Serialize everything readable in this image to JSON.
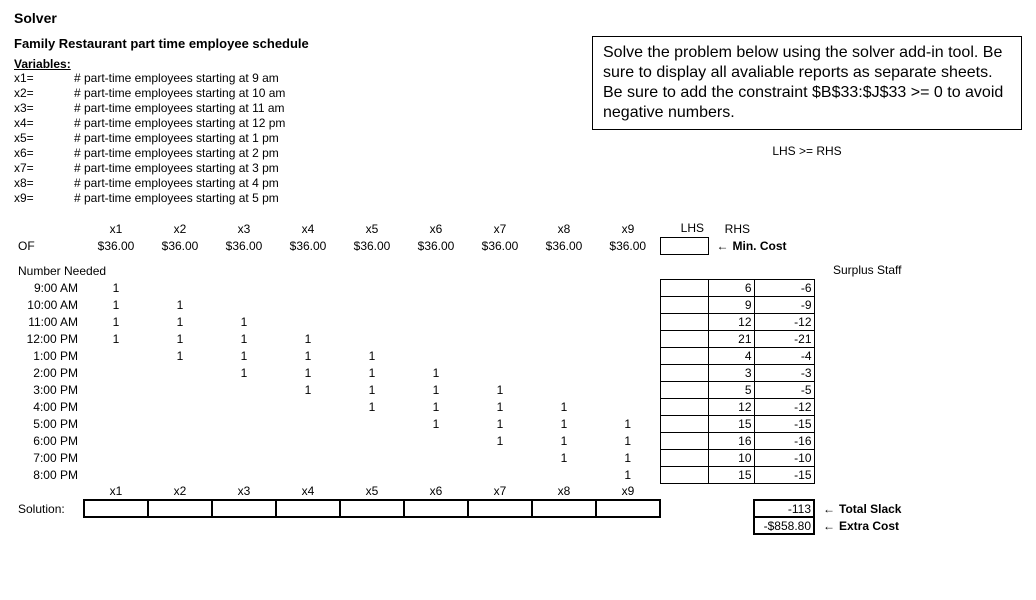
{
  "title": "Solver",
  "subtitle": "Family Restaurant part time employee schedule",
  "callout": "Solve the problem below using the solver add-in tool.  Be sure to display all avaliable reports as separate sheets.  Be sure to add the constraint $B$33:$J$33 >= 0 to avoid negative numbers.",
  "lhs_rhs_note": "LHS >= RHS",
  "variables_header": "Variables:",
  "variables": [
    {
      "name": "x1=",
      "desc": "# part-time employees starting at 9 am"
    },
    {
      "name": "x2=",
      "desc": "# part-time employees starting at 10 am"
    },
    {
      "name": "x3=",
      "desc": "# part-time employees starting at 11 am"
    },
    {
      "name": "x4=",
      "desc": "# part-time employees starting at 12 pm"
    },
    {
      "name": "x5=",
      "desc": "# part-time employees starting at 1 pm"
    },
    {
      "name": "x6=",
      "desc": "# part-time employees starting at 2 pm"
    },
    {
      "name": "x7=",
      "desc": "# part-time employees starting at 3 pm"
    },
    {
      "name": "x8=",
      "desc": "# part-time employees starting at 4 pm"
    },
    {
      "name": "x9=",
      "desc": "# part-time employees starting at 5 pm"
    }
  ],
  "x_headers": [
    "x1",
    "x2",
    "x3",
    "x4",
    "x5",
    "x6",
    "x7",
    "x8",
    "x9"
  ],
  "lhs_hdr": "LHS",
  "rhs_hdr": "RHS",
  "of_label": "OF",
  "of_values": [
    "$36.00",
    "$36.00",
    "$36.00",
    "$36.00",
    "$36.00",
    "$36.00",
    "$36.00",
    "$36.00",
    "$36.00"
  ],
  "of_note": "Min. Cost",
  "number_needed_hdr": "Number Needed",
  "surplus_hdr": "Surplus Staff",
  "rows": [
    {
      "time": "9:00 AM",
      "coef": [
        "1",
        "",
        "",
        "",
        "",
        "",
        "",
        "",
        ""
      ],
      "lhs": "",
      "rhs": "6",
      "surplus": "-6"
    },
    {
      "time": "10:00 AM",
      "coef": [
        "1",
        "1",
        "",
        "",
        "",
        "",
        "",
        "",
        ""
      ],
      "lhs": "",
      "rhs": "9",
      "surplus": "-9"
    },
    {
      "time": "11:00 AM",
      "coef": [
        "1",
        "1",
        "1",
        "",
        "",
        "",
        "",
        "",
        ""
      ],
      "lhs": "",
      "rhs": "12",
      "surplus": "-12"
    },
    {
      "time": "12:00 PM",
      "coef": [
        "1",
        "1",
        "1",
        "1",
        "",
        "",
        "",
        "",
        ""
      ],
      "lhs": "",
      "rhs": "21",
      "surplus": "-21"
    },
    {
      "time": "1:00 PM",
      "coef": [
        "",
        "1",
        "1",
        "1",
        "1",
        "",
        "",
        "",
        ""
      ],
      "lhs": "",
      "rhs": "4",
      "surplus": "-4"
    },
    {
      "time": "2:00 PM",
      "coef": [
        "",
        "",
        "1",
        "1",
        "1",
        "1",
        "",
        "",
        ""
      ],
      "lhs": "",
      "rhs": "3",
      "surplus": "-3"
    },
    {
      "time": "3:00 PM",
      "coef": [
        "",
        "",
        "",
        "1",
        "1",
        "1",
        "1",
        "",
        ""
      ],
      "lhs": "",
      "rhs": "5",
      "surplus": "-5"
    },
    {
      "time": "4:00 PM",
      "coef": [
        "",
        "",
        "",
        "",
        "1",
        "1",
        "1",
        "1",
        ""
      ],
      "lhs": "",
      "rhs": "12",
      "surplus": "-12"
    },
    {
      "time": "5:00 PM",
      "coef": [
        "",
        "",
        "",
        "",
        "",
        "1",
        "1",
        "1",
        "1"
      ],
      "lhs": "",
      "rhs": "15",
      "surplus": "-15"
    },
    {
      "time": "6:00 PM",
      "coef": [
        "",
        "",
        "",
        "",
        "",
        "",
        "1",
        "1",
        "1"
      ],
      "lhs": "",
      "rhs": "16",
      "surplus": "-16"
    },
    {
      "time": "7:00 PM",
      "coef": [
        "",
        "",
        "",
        "",
        "",
        "",
        "",
        "1",
        "1"
      ],
      "lhs": "",
      "rhs": "10",
      "surplus": "-10"
    },
    {
      "time": "8:00 PM",
      "coef": [
        "",
        "",
        "",
        "",
        "",
        "",
        "",
        "",
        "1"
      ],
      "lhs": "",
      "rhs": "15",
      "surplus": "-15"
    }
  ],
  "solution_label": "Solution:",
  "solution_values": [
    "",
    "",
    "",
    "",
    "",
    "",
    "",
    "",
    ""
  ],
  "total_slack": {
    "value": "-113",
    "label": "Total Slack"
  },
  "extra_cost": {
    "value": "-$858.80",
    "label": "Extra Cost"
  },
  "arrow": "←",
  "chart_data": {
    "type": "table",
    "title": "Family Restaurant part time employee schedule — solver model",
    "objective_function": {
      "label": "Min. Cost",
      "coefficients": [
        36,
        36,
        36,
        36,
        36,
        36,
        36,
        36,
        36
      ]
    },
    "decision_vars": [
      "x1",
      "x2",
      "x3",
      "x4",
      "x5",
      "x6",
      "x7",
      "x8",
      "x9"
    ],
    "constraints": [
      {
        "period": "9:00 AM",
        "coeff": [
          1,
          0,
          0,
          0,
          0,
          0,
          0,
          0,
          0
        ],
        "lhs": null,
        "rhs": 6,
        "surplus": -6
      },
      {
        "period": "10:00 AM",
        "coeff": [
          1,
          1,
          0,
          0,
          0,
          0,
          0,
          0,
          0
        ],
        "lhs": null,
        "rhs": 9,
        "surplus": -9
      },
      {
        "period": "11:00 AM",
        "coeff": [
          1,
          1,
          1,
          0,
          0,
          0,
          0,
          0,
          0
        ],
        "lhs": null,
        "rhs": 12,
        "surplus": -12
      },
      {
        "period": "12:00 PM",
        "coeff": [
          1,
          1,
          1,
          1,
          0,
          0,
          0,
          0,
          0
        ],
        "lhs": null,
        "rhs": 21,
        "surplus": -21
      },
      {
        "period": "1:00 PM",
        "coeff": [
          0,
          1,
          1,
          1,
          1,
          0,
          0,
          0,
          0
        ],
        "lhs": null,
        "rhs": 4,
        "surplus": -4
      },
      {
        "period": "2:00 PM",
        "coeff": [
          0,
          0,
          1,
          1,
          1,
          1,
          0,
          0,
          0
        ],
        "lhs": null,
        "rhs": 3,
        "surplus": -3
      },
      {
        "period": "3:00 PM",
        "coeff": [
          0,
          0,
          0,
          1,
          1,
          1,
          1,
          0,
          0
        ],
        "lhs": null,
        "rhs": 5,
        "surplus": -5
      },
      {
        "period": "4:00 PM",
        "coeff": [
          0,
          0,
          0,
          0,
          1,
          1,
          1,
          1,
          0
        ],
        "lhs": null,
        "rhs": 12,
        "surplus": -12
      },
      {
        "period": "5:00 PM",
        "coeff": [
          0,
          0,
          0,
          0,
          0,
          1,
          1,
          1,
          1
        ],
        "lhs": null,
        "rhs": 15,
        "surplus": -15
      },
      {
        "period": "6:00 PM",
        "coeff": [
          0,
          0,
          0,
          0,
          0,
          0,
          1,
          1,
          1
        ],
        "lhs": null,
        "rhs": 16,
        "surplus": -16
      },
      {
        "period": "7:00 PM",
        "coeff": [
          0,
          0,
          0,
          0,
          0,
          0,
          0,
          1,
          1
        ],
        "lhs": null,
        "rhs": 10,
        "surplus": -10
      },
      {
        "period": "8:00 PM",
        "coeff": [
          0,
          0,
          0,
          0,
          0,
          0,
          0,
          0,
          1
        ],
        "lhs": null,
        "rhs": 15,
        "surplus": -15
      }
    ],
    "relation": "LHS >= RHS",
    "solution": [
      null,
      null,
      null,
      null,
      null,
      null,
      null,
      null,
      null
    ],
    "total_slack": -113,
    "extra_cost": -858.8
  }
}
